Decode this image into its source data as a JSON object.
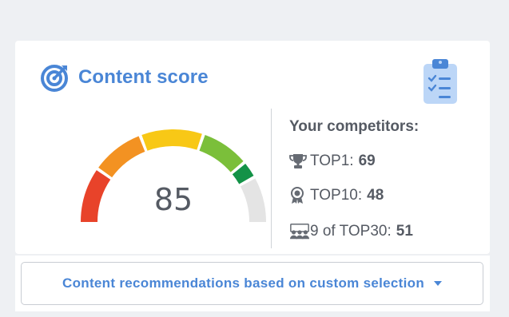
{
  "header": {
    "title": "Content score"
  },
  "score": {
    "value": "85",
    "level": 0.85,
    "segment_colors": [
      "#e8432a",
      "#f39222",
      "#f8c816",
      "#7bbf3a",
      "#139247",
      "#e4e4e4"
    ]
  },
  "competitors": {
    "title": "Your competitors:",
    "rows": [
      {
        "label": "TOP1:",
        "value": "69",
        "icon": "trophy-icon"
      },
      {
        "label": "TOP10:",
        "value": "48",
        "icon": "medal-icon"
      },
      {
        "label": "9 of TOP30:",
        "value": "51",
        "icon": "group-icon"
      }
    ]
  },
  "recommendations": {
    "label": "Content recommendations based on custom selection"
  },
  "colors": {
    "accent": "#4a86d6",
    "text": "#555a63"
  }
}
